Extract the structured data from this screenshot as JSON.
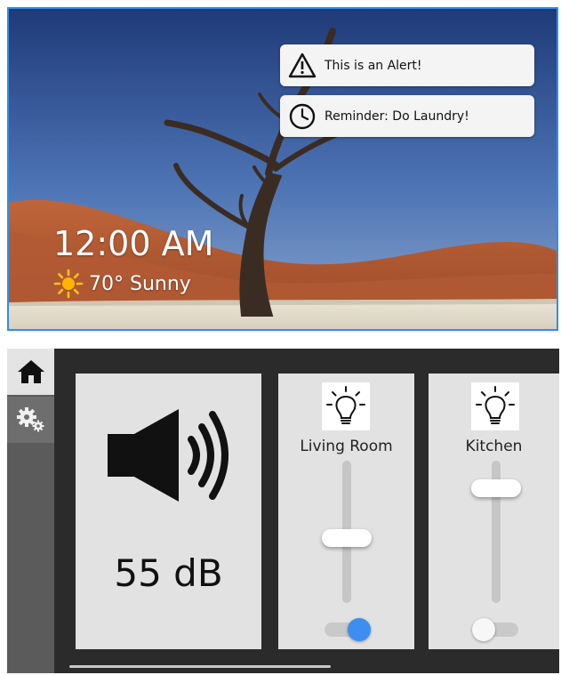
{
  "notifications": [
    {
      "icon": "warning-icon",
      "text": "This is an Alert!"
    },
    {
      "icon": "clock-icon",
      "text": "Reminder: Do Laundry!"
    }
  ],
  "clock": {
    "time": "12:00 AM"
  },
  "weather": {
    "icon": "sun-icon",
    "text": "70° Sunny"
  },
  "sidebar": {
    "items": [
      {
        "icon": "home-icon",
        "active": true
      },
      {
        "icon": "settings-icon",
        "active": false
      }
    ]
  },
  "volume": {
    "icon": "speaker-icon",
    "level_text": "55 dB"
  },
  "lights": [
    {
      "icon": "lightbulb-icon",
      "room": "Living Room",
      "brightness": 0.45,
      "on": true
    },
    {
      "icon": "lightbulb-icon",
      "room": "Kitchen",
      "brightness": 0.85,
      "on": false
    }
  ],
  "colors": {
    "accent": "#3d8ef0",
    "panel_bg": "#2b2b2b",
    "card_bg": "#e2e2e2",
    "sidebar_bg": "#5b5b5b",
    "frame_border": "#2f8fe6"
  }
}
